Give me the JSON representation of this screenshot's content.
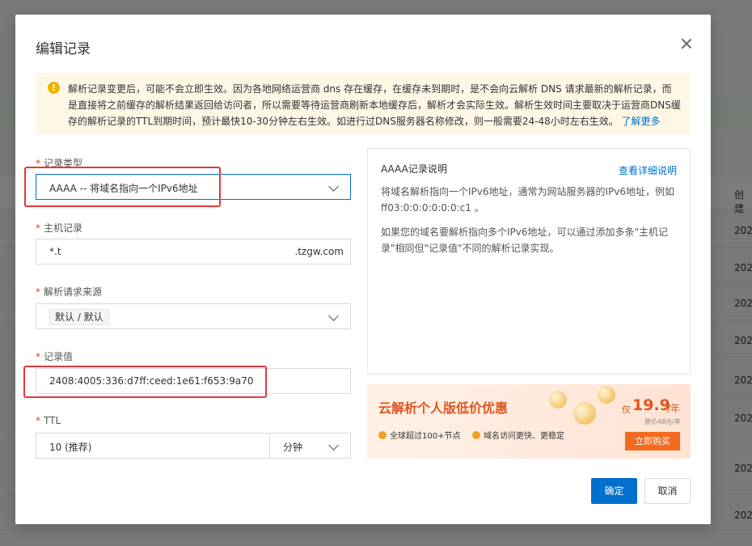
{
  "background": {
    "header_col": "创建",
    "rows": [
      "202",
      "202",
      "202",
      "202",
      "202",
      "202",
      "202",
      "202"
    ]
  },
  "dialog": {
    "title": "编辑记录",
    "alert": {
      "text": "解析记录变更后，可能不会立即生效。因为各地网络运营商 dns 存在缓存，在缓存未到期时，是不会向云解析 DNS 请求最新的解析记录，而是直接将之前缓存的解析结果返回给访问者，所以需要等待运营商刷新本地缓存后，解析才会实际生效。解析生效时间主要取决于运营商DNS缓存的解析记录的TTL到期时间，预计最快10-30分钟左右生效。如进行过DNS服务器名称修改，则一般需要24-48小时左右生效。",
      "link": "了解更多"
    },
    "form": {
      "record_type": {
        "label": "记录类型",
        "value": "AAAA -- 将域名指向一个IPv6地址"
      },
      "host": {
        "label": "主机记录",
        "value": "*.t",
        "suffix": ".tzgw.com"
      },
      "source": {
        "label": "解析请求来源",
        "value": "默认 / 默认"
      },
      "record_value": {
        "label": "记录值",
        "value": "2408:4005:336:d7ff:ceed:1e61:f653:9a70"
      },
      "ttl": {
        "label": "TTL",
        "value": "10 (推荐)",
        "unit": "分钟"
      }
    },
    "info": {
      "title": "AAAA记录说明",
      "link": "查看详细说明",
      "p1": "将域名解析指向一个IPv6地址，通常为网站服务器的IPv6地址，例如ff03:0:0:0:0:0:0:c1 。",
      "p2": "如果您的域名要解析指向多个IPv6地址，可以通过添加多条\"主机记录\"相同但\"记录值\"不同的解析记录实现。"
    },
    "promo": {
      "title": "云解析个人版低价优惠",
      "feature1": "全球超过100+节点",
      "feature2": "域名访问更快、更稳定",
      "price_prefix": "仅",
      "price": "19.9",
      "unit": "/年",
      "original": "原价48元/年",
      "button": "立即购买"
    },
    "buttons": {
      "ok": "确定",
      "cancel": "取消"
    }
  }
}
